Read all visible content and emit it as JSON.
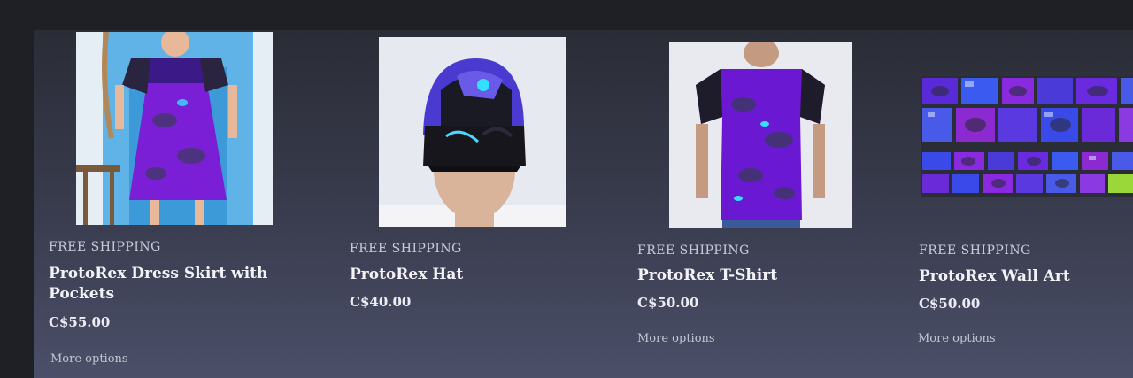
{
  "products": [
    {
      "badge": "FREE SHIPPING",
      "title": "ProtoRex Dress Skirt with Pockets",
      "price": "C$55.00",
      "action": "More options",
      "image_icon": "dress-product-image"
    },
    {
      "badge": "FREE SHIPPING",
      "title": "ProtoRex Hat",
      "price": "C$40.00",
      "action": "",
      "image_icon": "hat-product-image"
    },
    {
      "badge": "FREE SHIPPING",
      "title": "ProtoRex T-Shirt",
      "price": "C$50.00",
      "action": "More options",
      "image_icon": "tshirt-product-image"
    },
    {
      "badge": "FREE SHIPPING",
      "title": "ProtoRex Wall Art",
      "price": "C$50.00",
      "action": "More options",
      "image_icon": "wall-art-product-image"
    }
  ],
  "colors": {
    "background": "#2a2c36",
    "text": "#f2f2f7",
    "accent_purple": "#7a1fd6",
    "accent_cyan": "#33e0ff"
  }
}
